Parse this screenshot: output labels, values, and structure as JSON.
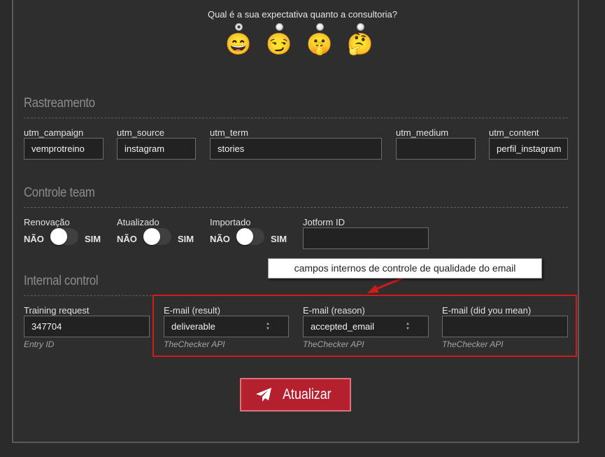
{
  "expectation": {
    "question": "Qual é a sua expectativa quanto a consultoria?",
    "options": [
      {
        "emoji": "😄",
        "icon": "grinning-face-icon",
        "checked": true
      },
      {
        "emoji": "😏",
        "icon": "smirking-face-icon",
        "checked": false
      },
      {
        "emoji": "🤫",
        "icon": "shushing-face-icon",
        "checked": false
      },
      {
        "emoji": "🤔",
        "icon": "thinking-face-icon",
        "checked": false
      }
    ]
  },
  "tracking": {
    "title": "Rastreamento",
    "fields": [
      {
        "label": "utm_campaign",
        "value": "vemprotreino"
      },
      {
        "label": "utm_source",
        "value": "instagram"
      },
      {
        "label": "utm_term",
        "value": "stories"
      },
      {
        "label": "utm_medium",
        "value": ""
      },
      {
        "label": "utm_content",
        "value": "perfil_instagram"
      }
    ]
  },
  "team_control": {
    "title": "Controle team",
    "toggles": [
      {
        "label": "Renovação",
        "off": "NÃO",
        "on": "SIM",
        "state": false
      },
      {
        "label": "Atualizado",
        "off": "NÃO",
        "on": "SIM",
        "state": false
      },
      {
        "label": "Importado",
        "off": "NÃO",
        "on": "SIM",
        "state": false
      }
    ],
    "jotform": {
      "label": "Jotform ID",
      "value": ""
    }
  },
  "internal_control": {
    "title": "Internal control",
    "training": {
      "label": "Training request",
      "value": "347704",
      "hint": "Entry ID"
    },
    "email_result": {
      "label": "E-mail (result)",
      "value": "deliverable",
      "hint": "TheChecker API"
    },
    "email_reason": {
      "label": "E-mail (reason)",
      "value": "accepted_email",
      "hint": "TheChecker API"
    },
    "email_mean": {
      "label": "E-mail (did you mean)",
      "value": "",
      "hint": "TheChecker API"
    }
  },
  "annotation": {
    "text": "campos internos de controle de qualidade do email",
    "arrow_color": "#d11a1a"
  },
  "submit": {
    "label": "Atualizar",
    "icon": "paper-plane-icon",
    "color": "#b4202e"
  }
}
